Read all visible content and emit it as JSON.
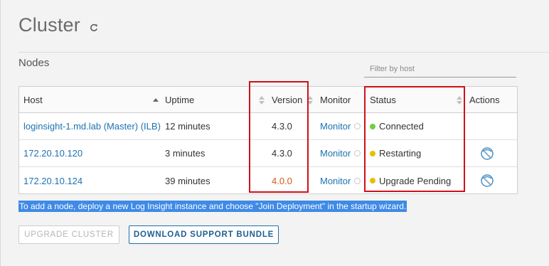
{
  "page": {
    "title": "Cluster"
  },
  "nodes": {
    "label": "Nodes",
    "filter_placeholder": "Filter by host",
    "columns": {
      "host": "Host",
      "uptime": "Uptime",
      "version": "Version",
      "monitor": "Monitor",
      "status": "Status",
      "actions": "Actions"
    },
    "rows": [
      {
        "host": "loginsight-1.md.lab (Master) (ILB)",
        "uptime": "12 minutes",
        "version": "4.3.0",
        "monitor": "Monitor",
        "status": "Connected",
        "status_color": "#6fcf3c",
        "has_action": false
      },
      {
        "host": "172.20.10.120",
        "uptime": "3 minutes",
        "version": "4.3.0",
        "monitor": "Monitor",
        "status": "Restarting",
        "status_color": "#e8c000",
        "has_action": true
      },
      {
        "host": "172.20.10.124",
        "uptime": "39 minutes",
        "version": "4.0.0",
        "version_color": "#d45a1a",
        "monitor": "Monitor",
        "status": "Upgrade Pending",
        "status_color": "#e8c000",
        "has_action": true
      }
    ]
  },
  "info_text": "To add a node, deploy a new Log Insight instance and choose \"Join Deployment\" in the startup wizard.",
  "buttons": {
    "upgrade": "UPGRADE CLUSTER",
    "download": "DOWNLOAD SUPPORT BUNDLE"
  },
  "colors": {
    "link": "#1d73b0",
    "highlight": "#3e8ae6",
    "annotation_red": "#d0101a"
  },
  "icons": {
    "refresh": "refresh-icon",
    "monitor": "monitor-status-icon",
    "action": "upgrade-action-icon"
  }
}
